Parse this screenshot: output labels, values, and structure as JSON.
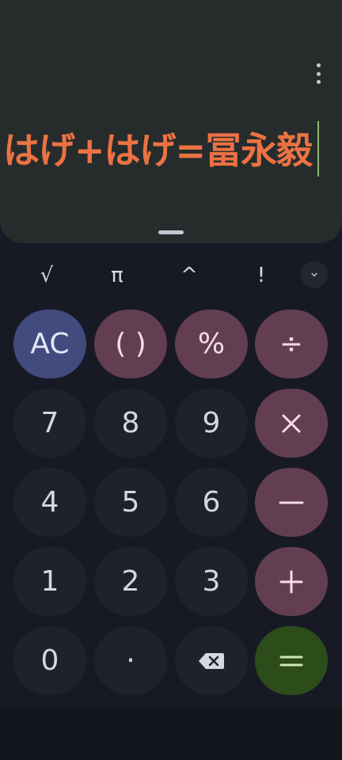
{
  "display": {
    "expression": "はげ+はげ=冨永毅",
    "menu_icon": "more-vert-icon"
  },
  "scientific": {
    "keys": [
      "√",
      "π",
      "^",
      "!"
    ],
    "expand_icon": "chevron-down-icon"
  },
  "keypad": {
    "ac": "AC",
    "parens": "( )",
    "percent": "%",
    "divide": "÷",
    "seven": "7",
    "eight": "8",
    "nine": "9",
    "four": "4",
    "five": "5",
    "six": "6",
    "one": "1",
    "two": "2",
    "three": "3",
    "zero": "0",
    "decimal": "·",
    "backspace_icon": "backspace-icon",
    "multiply_icon": "multiply-icon",
    "minus_icon": "minus-icon",
    "plus_icon": "plus-icon",
    "equals_icon": "equals-icon"
  },
  "colors": {
    "expression_text": "#ec7243",
    "ac_key": "#424b7e",
    "operator_key": "#633e51",
    "equals_key": "#2c4c19",
    "digit_key": "#1e222c"
  }
}
